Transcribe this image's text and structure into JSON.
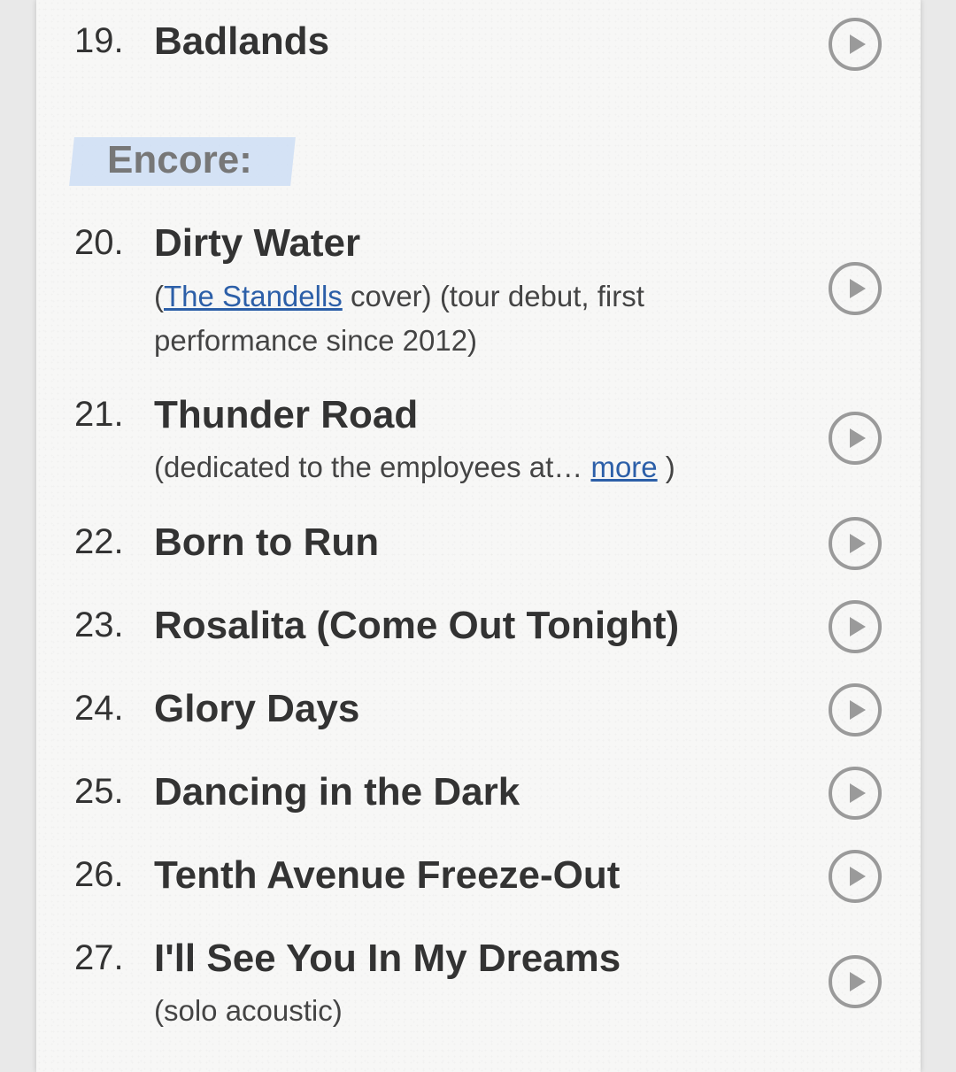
{
  "section_label": "Encore:",
  "songs": [
    {
      "number": "19.",
      "title": "Badlands"
    },
    {
      "number": "20.",
      "title": "Dirty Water",
      "note_prefix": "(",
      "note_link": "The Standells",
      "note_suffix": " cover) (tour debut, first performance since 2012)"
    },
    {
      "number": "21.",
      "title": "Thunder Road",
      "note_prefix": "(dedicated to the employees at… ",
      "note_link": "more",
      "note_suffix": " )"
    },
    {
      "number": "22.",
      "title": "Born to Run"
    },
    {
      "number": "23.",
      "title": "Rosalita (Come Out Tonight)"
    },
    {
      "number": "24.",
      "title": "Glory Days"
    },
    {
      "number": "25.",
      "title": "Dancing in the Dark"
    },
    {
      "number": "26.",
      "title": "Tenth Avenue Freeze-Out"
    },
    {
      "number": "27.",
      "title": "I'll See You In My Dreams",
      "note_text": "(solo acoustic)"
    }
  ],
  "icons": {
    "play": "play-circle-icon"
  },
  "colors": {
    "link": "#2c5fa8",
    "highlight": "#cfdff5",
    "icon": "#9a9a9a",
    "text": "#333333"
  }
}
